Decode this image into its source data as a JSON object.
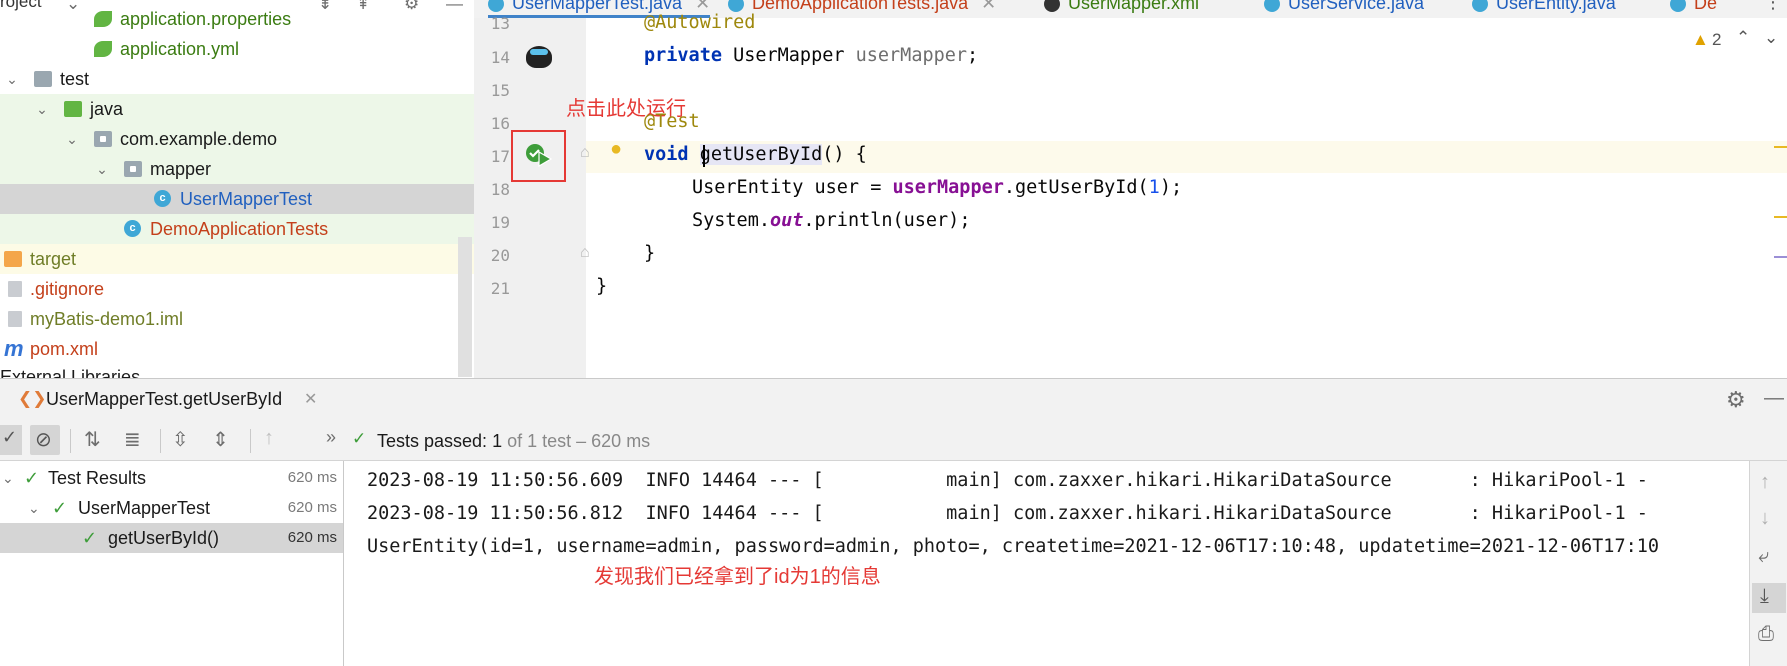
{
  "project": {
    "title": "roject",
    "rows": [
      {
        "label": "application.properties",
        "color": "green"
      },
      {
        "label": "application.yml",
        "color": "green"
      },
      {
        "label": "test",
        "color": "dark"
      },
      {
        "label": "java",
        "color": "dark"
      },
      {
        "label": "com.example.demo",
        "color": "dark"
      },
      {
        "label": "mapper",
        "color": "dark"
      },
      {
        "label": "UserMapperTest",
        "color": "blue"
      },
      {
        "label": "DemoApplicationTests",
        "color": "red"
      },
      {
        "label": "target",
        "color": "olive"
      },
      {
        "label": ".gitignore",
        "color": "red"
      },
      {
        "label": "myBatis-demo1.iml",
        "color": "olive"
      },
      {
        "label": "pom.xml",
        "color": "red"
      },
      {
        "label": "External Libraries",
        "color": "dark"
      }
    ],
    "pom_icon_letter": "m"
  },
  "editor": {
    "tabs": [
      {
        "label": "UserMapperTest.java"
      },
      {
        "label": "DemoApplicationTests.java"
      },
      {
        "label": "UserMapper.xml"
      },
      {
        "label": "UserService.java"
      },
      {
        "label": "UserEntity.java"
      },
      {
        "label": "De"
      }
    ],
    "line_numbers": [
      "13",
      "14",
      "15",
      "16",
      "17",
      "18",
      "19",
      "20",
      "21"
    ],
    "code": {
      "l13": "@Autowired",
      "l14_kw": "private",
      "l14_type": " UserMapper ",
      "l14_field": "userMapper",
      "l14_end": ";",
      "l16": "@Test",
      "l17_kw": "void",
      "l17_method": "getUserById",
      "l17_end": "() {",
      "l18_a": "UserEntity user = ",
      "l18_field": "userMapper",
      "l18_b": ".getUserById(",
      "l18_num": "1",
      "l18_c": ");",
      "l19_a": "System.",
      "l19_out": "out",
      "l19_b": ".println(user);",
      "l20": "}",
      "l21": "}"
    },
    "warning_count": "2",
    "annotation_run": "点击此处运行"
  },
  "run_panel": {
    "tab_label": "UserMapperTest.getUserById",
    "status_prefix": "Tests passed:",
    "status_count": "1",
    "status_suffix": "of 1 test – 620 ms",
    "results": [
      {
        "label": "Test Results",
        "time": "620 ms"
      },
      {
        "label": "UserMapperTest",
        "time": "620 ms"
      },
      {
        "label": "getUserById()",
        "time": "620 ms"
      }
    ],
    "console": [
      "2023-08-19 11:50:56.609  INFO 14464 --- [           main] com.zaxxer.hikari.HikariDataSource       : HikariPool-1 -",
      "2023-08-19 11:50:56.812  INFO 14464 --- [           main] com.zaxxer.hikari.HikariDataSource       : HikariPool-1 -",
      "UserEntity(id=1, username=admin, password=admin, photo=, createtime=2021-12-06T17:10:48, updatetime=2021-12-06T17:10"
    ],
    "annotation_result": "发现我们已经拿到了id为1的信息"
  }
}
